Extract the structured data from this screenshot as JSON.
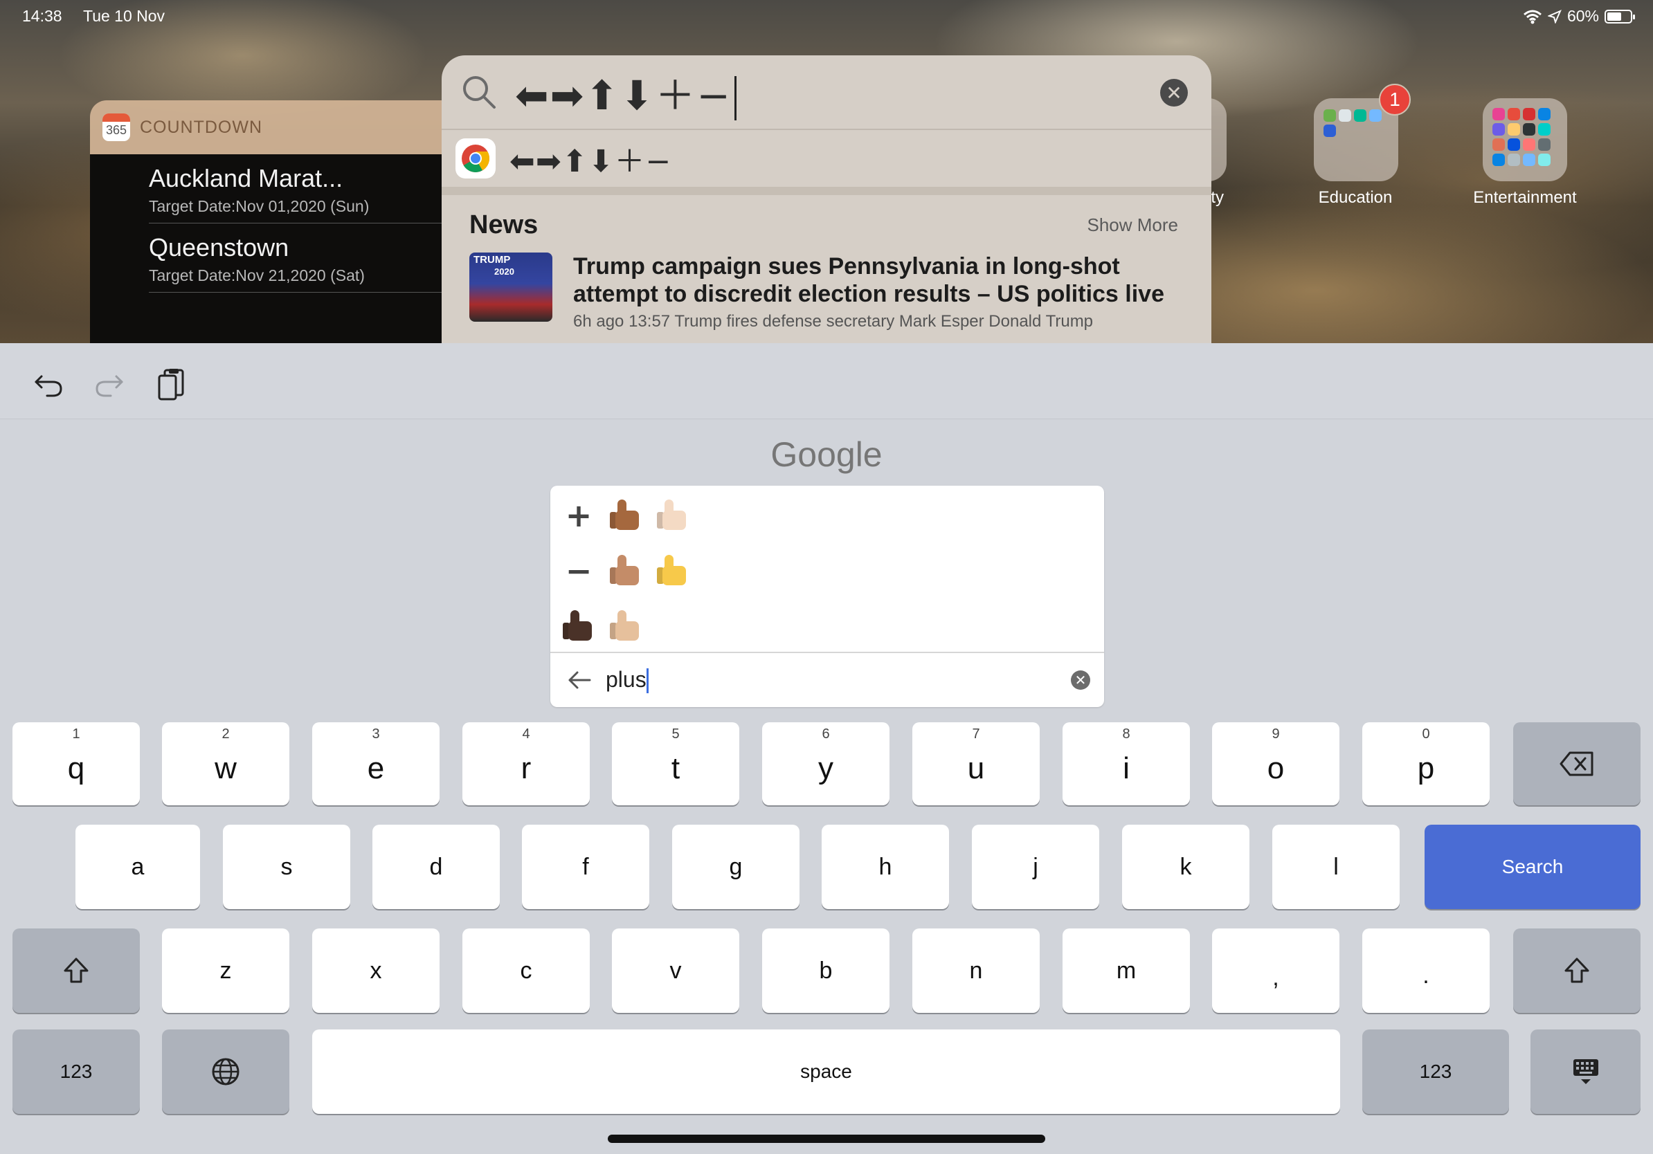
{
  "status_bar": {
    "time": "14:38",
    "date": "Tue 10 Nov",
    "battery": "60%"
  },
  "countdown_widget": {
    "app_icon_number": "365",
    "title": "COUNTDOWN",
    "items": [
      {
        "name": "Auckland Marat...",
        "date": "Target Date:Nov 01,2020 (Sun)"
      },
      {
        "name": "Queenstown",
        "date": "Target Date:Nov 21,2020 (Sat)"
      }
    ]
  },
  "folders": [
    {
      "label": "Education",
      "badge": "1"
    },
    {
      "label": "Entertainment"
    }
  ],
  "partial_folder_label": "ity",
  "spotlight": {
    "query": "⬅➡⬆⬇＋−",
    "suggestion": "⬅➡⬆⬇＋−",
    "news": {
      "title": "News",
      "show_more": "Show More",
      "thumb_text": "TRUMP",
      "thumb_text2": "2020",
      "headline": "Trump campaign sues Pennsylvania in long-shot attempt to discredit election results – US politics live",
      "snippet": "6h ago 13:57 Trump fires defense secretary Mark Esper Donald Trump"
    }
  },
  "google_logo": "Google",
  "emoji_panel": {
    "symbol_plus": "+",
    "symbol_minus": "−",
    "search_value": "plus",
    "skin_tones": [
      "#a5683e",
      "#f4dac4",
      "#c48c68",
      "#f7c94a",
      "#4a3228",
      "#e6c09c"
    ]
  },
  "keyboard": {
    "row1": [
      {
        "hint": "1",
        "key": "q"
      },
      {
        "hint": "2",
        "key": "w"
      },
      {
        "hint": "3",
        "key": "e"
      },
      {
        "hint": "4",
        "key": "r"
      },
      {
        "hint": "5",
        "key": "t"
      },
      {
        "hint": "6",
        "key": "y"
      },
      {
        "hint": "7",
        "key": "u"
      },
      {
        "hint": "8",
        "key": "i"
      },
      {
        "hint": "9",
        "key": "o"
      },
      {
        "hint": "0",
        "key": "p"
      }
    ],
    "row2": [
      "a",
      "s",
      "d",
      "f",
      "g",
      "h",
      "j",
      "k",
      "l"
    ],
    "search_label": "Search",
    "row3": [
      "z",
      "x",
      "c",
      "v",
      "b",
      "n",
      "m",
      ",",
      "."
    ],
    "numbers_label": "123",
    "space_label": "space"
  },
  "colors": {
    "search_key": "#4a6cd4",
    "badge": "#e8423a"
  }
}
